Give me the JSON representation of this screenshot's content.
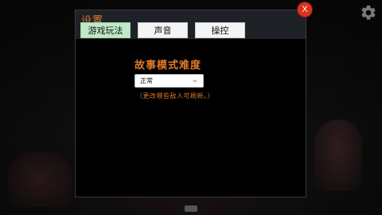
{
  "dialog": {
    "title": "设置",
    "close_label": "X",
    "tabs": [
      {
        "label": "游戏玩法",
        "active": true
      },
      {
        "label": "声音",
        "active": false
      },
      {
        "label": "操控",
        "active": false
      }
    ]
  },
  "gameplay": {
    "story_difficulty_title": "故事模式难度",
    "difficulty_select": {
      "selected": "正常"
    },
    "hint": "（更改哪些敌人可刷新。）"
  },
  "colors": {
    "accent_orange": "#e07a2a",
    "active_tab": "#bfe9c8",
    "close_red": "#d8321e"
  },
  "icons": {
    "settings": "gear-icon",
    "close": "close-icon",
    "dropdown": "chevron-down-icon"
  }
}
